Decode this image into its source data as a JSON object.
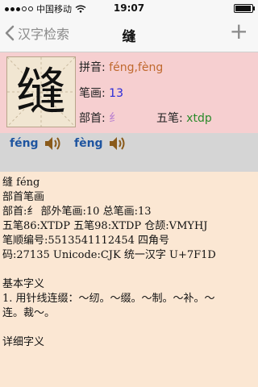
{
  "status": {
    "carrier": "中国移动",
    "time": "19:07"
  },
  "nav": {
    "back_label": "汉字检索",
    "title": "缝",
    "add_symbol": "+"
  },
  "character": {
    "glyph": "缝",
    "pinyin_label": "拼音:",
    "pinyin_value": "féng,fèng",
    "strokes_label": "笔画:",
    "strokes_value": "13",
    "radical_label": "部首:",
    "radical_value": "纟",
    "wubi_label": "五笔:",
    "wubi_value": "xtdp"
  },
  "audio": [
    {
      "pinyin": "féng"
    },
    {
      "pinyin": "fèng"
    }
  ],
  "detail": {
    "l1": "缝 féng",
    "l2": "部首笔画",
    "l3": "部首:纟 部外笔画:10 总笔画:13",
    "l4": "五笔86:XTDP 五笔98:XTDP 仓颉:VMYHJ",
    "l5": "笔顺编号:5513541112454 四角号",
    "l6": "码:27135 Unicode:CJK 统一汉字 U+7F1D",
    "l7": "基本字义",
    "l8": "1. 用针线连缀：～纫。～缀。～制。～补。～",
    "l9": "连。裁～。",
    "l10": "详细字义"
  },
  "colors": {
    "header_bg": "#f6cfd0",
    "content_bg": "#fbe7d3",
    "audio_bg": "#d5d5d5"
  }
}
